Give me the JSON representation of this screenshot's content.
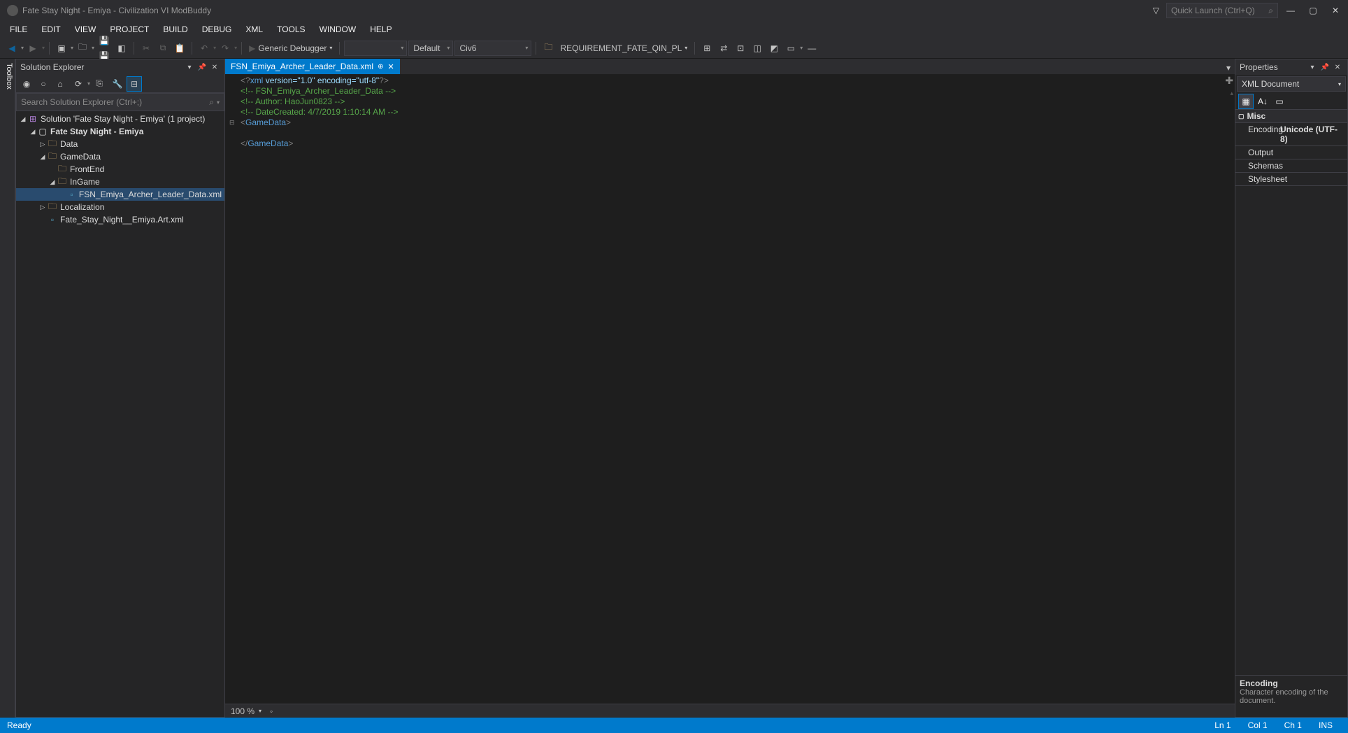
{
  "titlebar": {
    "title": "Fate Stay Night - Emiya - Civilization VI ModBuddy",
    "quick_launch_placeholder": "Quick Launch (Ctrl+Q)"
  },
  "menubar": [
    "FILE",
    "EDIT",
    "VIEW",
    "PROJECT",
    "BUILD",
    "DEBUG",
    "XML",
    "TOOLS",
    "WINDOW",
    "HELP"
  ],
  "toolbar": {
    "debugger_label": "Generic Debugger",
    "config": "Default",
    "platform": "Civ6",
    "requirement": "REQUIREMENT_FATE_QIN_PL"
  },
  "toolbox_tab": "Toolbox",
  "solution_explorer": {
    "title": "Solution Explorer",
    "search_placeholder": "Search Solution Explorer (Ctrl+;)",
    "solution_label": "Solution 'Fate Stay Night - Emiya' (1 project)",
    "project": "Fate Stay Night - Emiya",
    "folders": {
      "data": "Data",
      "gamedata": "GameData",
      "frontend": "FrontEnd",
      "ingame": "InGame",
      "localization": "Localization"
    },
    "files": {
      "leader_data": "FSN_Emiya_Archer_Leader_Data.xml",
      "art": "Fate_Stay_Night__Emiya.Art.xml"
    }
  },
  "editor": {
    "tab_name": "FSN_Emiya_Archer_Leader_Data.xml",
    "zoom": "100 %",
    "code": {
      "xml_decl_pre": "<?",
      "xml_decl_name": "xml",
      "xml_decl_attrs": " version=\"1.0\" encoding=\"utf-8\"",
      "xml_decl_post": "?>",
      "comment1": "<!-- FSN_Emiya_Archer_Leader_Data -->",
      "comment2": "<!-- Author: HaoJun0823 -->",
      "comment3": "<!-- DateCreated: 4/7/2019 1:10:14 AM -->",
      "tag_open_lt": "<",
      "tag_open_name": "GameData",
      "tag_open_gt": ">",
      "tag_close_lt": "</",
      "tag_close_name": "GameData",
      "tag_close_gt": ">"
    }
  },
  "properties": {
    "title": "Properties",
    "doc_type": "XML Document",
    "category": "Misc",
    "rows": {
      "encoding_k": "Encoding",
      "encoding_v": "Unicode (UTF-8)",
      "output_k": "Output",
      "schemas_k": "Schemas",
      "stylesheet_k": "Stylesheet"
    },
    "help_title": "Encoding",
    "help_desc": "Character encoding of the document."
  },
  "statusbar": {
    "ready": "Ready",
    "ln": "Ln 1",
    "col": "Col 1",
    "ch": "Ch 1",
    "ins": "INS"
  }
}
